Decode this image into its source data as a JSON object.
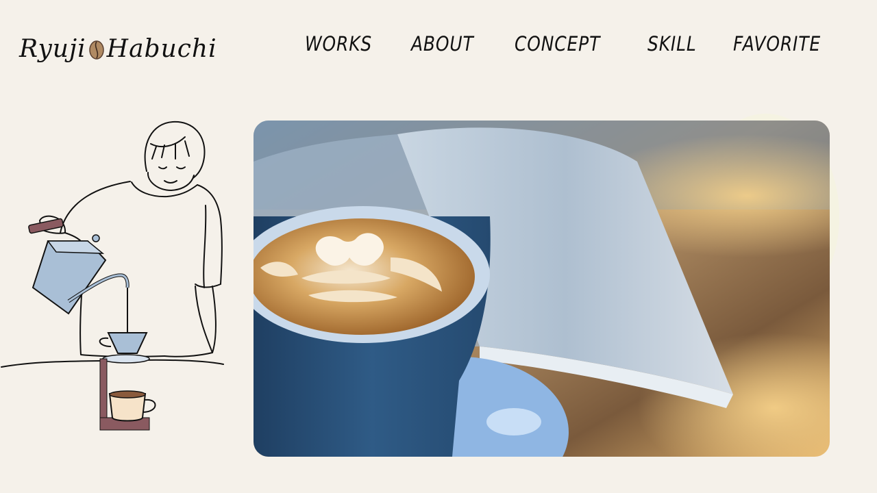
{
  "header": {
    "logo": {
      "text_left": "Ryuji",
      "text_right": "Habuchi",
      "icon": "coffee-bean-icon"
    },
    "nav": [
      {
        "label": "WORKS"
      },
      {
        "label": "ABOUT"
      },
      {
        "label": "CONCEPT"
      },
      {
        "label": "SKILL"
      },
      {
        "label": "FAVORITE"
      }
    ]
  },
  "main": {
    "illustration": {
      "subject": "person pouring drip coffee"
    },
    "hero_image": {
      "subject": "latte art cup beside open book"
    }
  },
  "colors": {
    "background": "#f5f1ea",
    "text": "#111111",
    "kettle": "#a9bfd6",
    "stand": "#8a5a60",
    "cup_blue": "#2f5b86",
    "crema": "#c48a3c"
  }
}
